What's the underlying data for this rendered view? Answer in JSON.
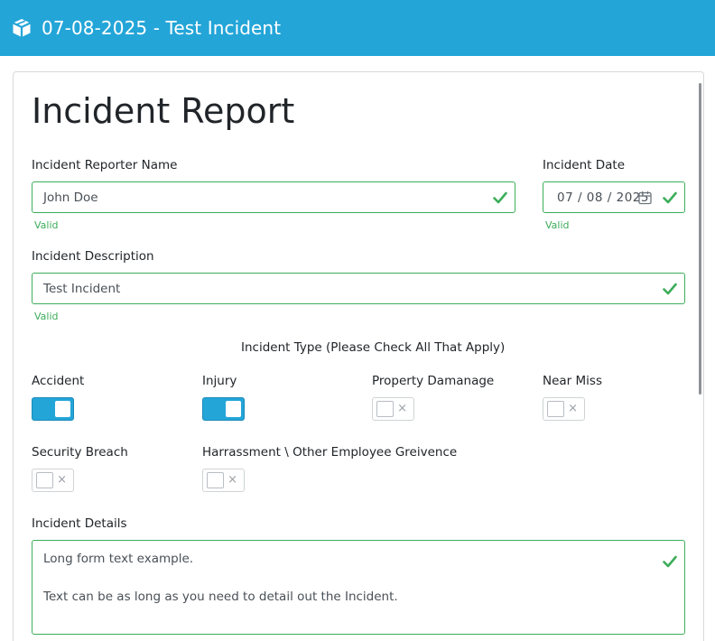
{
  "header": {
    "title": "07-08-2025 - Test Incident"
  },
  "form": {
    "heading": "Incident Report",
    "reporter": {
      "label": "Incident Reporter Name",
      "value": "John Doe",
      "valid": "Valid"
    },
    "date": {
      "label": "Incident Date",
      "value": "07 / 08 / 2025",
      "valid": "Valid"
    },
    "description": {
      "label": "Incident Description",
      "value": "Test Incident",
      "valid": "Valid"
    },
    "incident_type": {
      "title": "Incident Type (Please Check All That Apply)",
      "options": [
        {
          "label": "Accident",
          "checked": true
        },
        {
          "label": "Injury",
          "checked": true
        },
        {
          "label": "Property Damanage",
          "checked": false
        },
        {
          "label": "Near Miss",
          "checked": false
        },
        {
          "label": "Security Breach",
          "checked": false
        },
        {
          "label": "Harrassment \\ Other Employee Greivence",
          "checked": false
        }
      ],
      "off_glyph": "×"
    },
    "details": {
      "label": "Incident Details",
      "line1": "Long form text example.",
      "line2": "Text can be as long as you need to detail out the Incident."
    }
  },
  "colors": {
    "header_bg": "#23a5d8",
    "valid_green": "#3cad5a",
    "toggle_on": "#23a5d8"
  },
  "icons": {
    "header": "cube-icon",
    "valid": "checkmark-icon",
    "date": "calendar-icon"
  }
}
